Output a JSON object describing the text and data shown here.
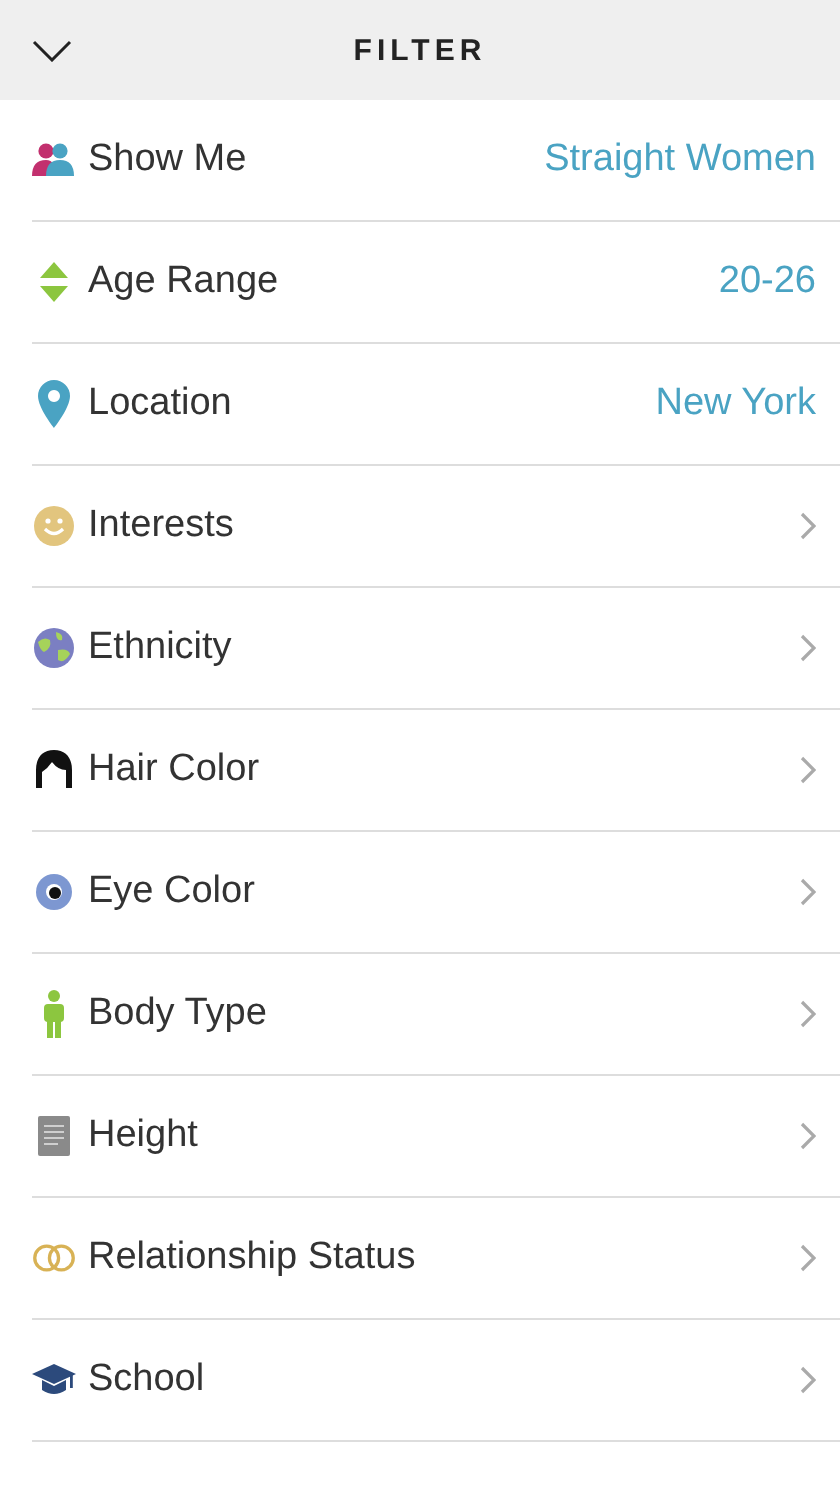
{
  "header": {
    "title": "FILTER"
  },
  "rows": [
    {
      "label": "Show Me",
      "kind": "value",
      "value": "Straight Women"
    },
    {
      "label": "Age Range",
      "kind": "value",
      "value": "20-26"
    },
    {
      "label": "Location",
      "kind": "value",
      "value": "New York"
    },
    {
      "label": "Interests",
      "kind": "link"
    },
    {
      "label": "Ethnicity",
      "kind": "link"
    },
    {
      "label": "Hair Color",
      "kind": "link"
    },
    {
      "label": "Eye Color",
      "kind": "link"
    },
    {
      "label": "Body Type",
      "kind": "link"
    },
    {
      "label": "Height",
      "kind": "link"
    },
    {
      "label": "Relationship Status",
      "kind": "link"
    },
    {
      "label": "School",
      "kind": "link"
    }
  ]
}
